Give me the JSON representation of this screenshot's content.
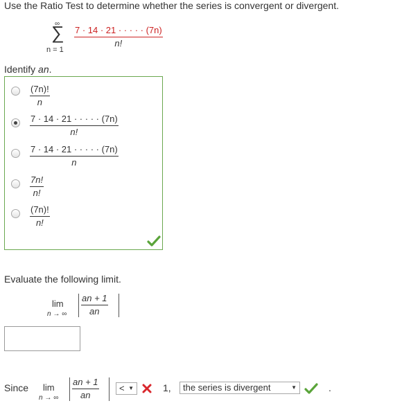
{
  "question": {
    "prompt": "Use the Ratio Test to determine whether the series is convergent or divergent.",
    "sum_symbol": "∑",
    "sum_upper": "∞",
    "sum_lower": "n = 1",
    "series_numerator": "7 · 14 · 21 · · · · · (7n)",
    "series_denominator": "n!"
  },
  "identify": {
    "label": "Identify",
    "label_var": "an",
    "label_end": ".",
    "options": [
      {
        "numerator": "(7n)!",
        "denominator": "n",
        "selected": false
      },
      {
        "numerator": "7 · 14 · 21 · · · · · (7n)",
        "denominator": "n!",
        "selected": true
      },
      {
        "numerator": "7 · 14 · 21 · · · · · (7n)",
        "denominator": "n",
        "selected": false
      },
      {
        "numerator": "7n!",
        "denominator": "n!",
        "selected": false
      },
      {
        "numerator": "(7n)!",
        "denominator": "n!",
        "selected": false
      }
    ],
    "status_icon": "check-icon"
  },
  "limit": {
    "label": "Evaluate the following limit.",
    "lim": "lim",
    "lim_sub": "n → ∞",
    "ratio_numerator": "an + 1",
    "ratio_denominator": "an",
    "answer_value": ""
  },
  "conclusion": {
    "since": "Since",
    "lim": "lim",
    "lim_sub": "n → ∞",
    "ratio_numerator": "an + 1",
    "ratio_denominator": "an",
    "comparison_value": "<",
    "comparison_status_icon": "x-icon",
    "one": "1,",
    "conclusion_value": "the series is divergent",
    "conclusion_status_icon": "check-icon",
    "period": "."
  },
  "colors": {
    "correct": "#5aa43a",
    "incorrect": "#d9262c",
    "highlight": "#cc2222",
    "border_ok": "#6aa84f"
  }
}
